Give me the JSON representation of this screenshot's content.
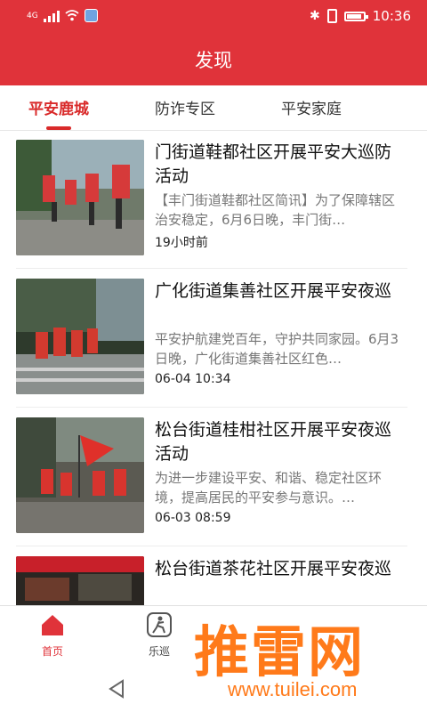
{
  "status": {
    "network": "4G",
    "time": "10:36"
  },
  "appbar": {
    "title": "发现"
  },
  "tabs": [
    {
      "label": "平安鹿城"
    },
    {
      "label": "防诈专区"
    },
    {
      "label": "平安家庭"
    }
  ],
  "articles": [
    {
      "title": "门街道鞋都社区开展平安大巡防活动",
      "snippet": "【丰门街道鞋都社区简讯】为了保障辖区治安稳定，6月6日晚，丰门街…",
      "time": "19小时前"
    },
    {
      "title": "广化街道集善社区开展平安夜巡",
      "snippet": "平安护航建党百年，守护共同家园。6月3日晚，广化街道集善社区红色…",
      "time": "06-04 10:34"
    },
    {
      "title": "松台街道桂柑社区开展平安夜巡活动",
      "snippet": "为进一步建设平安、和谐、稳定社区环境，提高居民的平安参与意识。…",
      "time": "06-03 08:59"
    },
    {
      "title": "松台街道茶花社区开展平安夜巡",
      "snippet": "",
      "time": ""
    }
  ],
  "bottom_nav": [
    {
      "label": "首页"
    },
    {
      "label": "乐巡"
    }
  ],
  "watermark": {
    "text": "推雷网",
    "url": "www.tuilei.com"
  },
  "colors": {
    "brand_red": "#e0333a",
    "active_tab": "#d92a2a",
    "watermark": "#ff7a1a"
  }
}
